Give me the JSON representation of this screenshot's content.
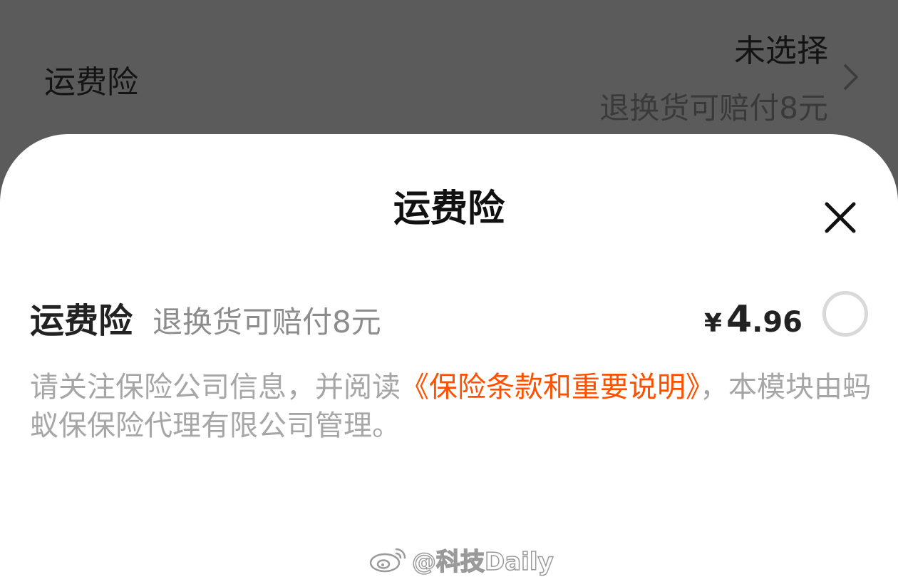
{
  "background_row": {
    "title": "运费险",
    "status": "未选择",
    "description": "退换货可赔付8元"
  },
  "sheet": {
    "title": "运费险",
    "option": {
      "name": "运费险",
      "description": "退换货可赔付8元",
      "currency": "¥",
      "price_integer": "4",
      "price_decimal": ".96",
      "selected": false
    },
    "notice": {
      "prefix": "请关注保险公司信息，并阅读",
      "link_text": "《保险条款和重要说明》",
      "suffix": "，本模块由蚂蚁保保险代理有限公司管理。"
    }
  },
  "watermark": {
    "text": "@科技Daily"
  },
  "colors": {
    "accent": "#ff5000",
    "overlay": "#5b5b5b",
    "muted_text": "#a6a6a6"
  },
  "icons": {
    "chevron": "chevron-right-icon",
    "close": "close-icon",
    "radio": "radio-unchecked",
    "watermark_logo": "weibo-logo"
  }
}
